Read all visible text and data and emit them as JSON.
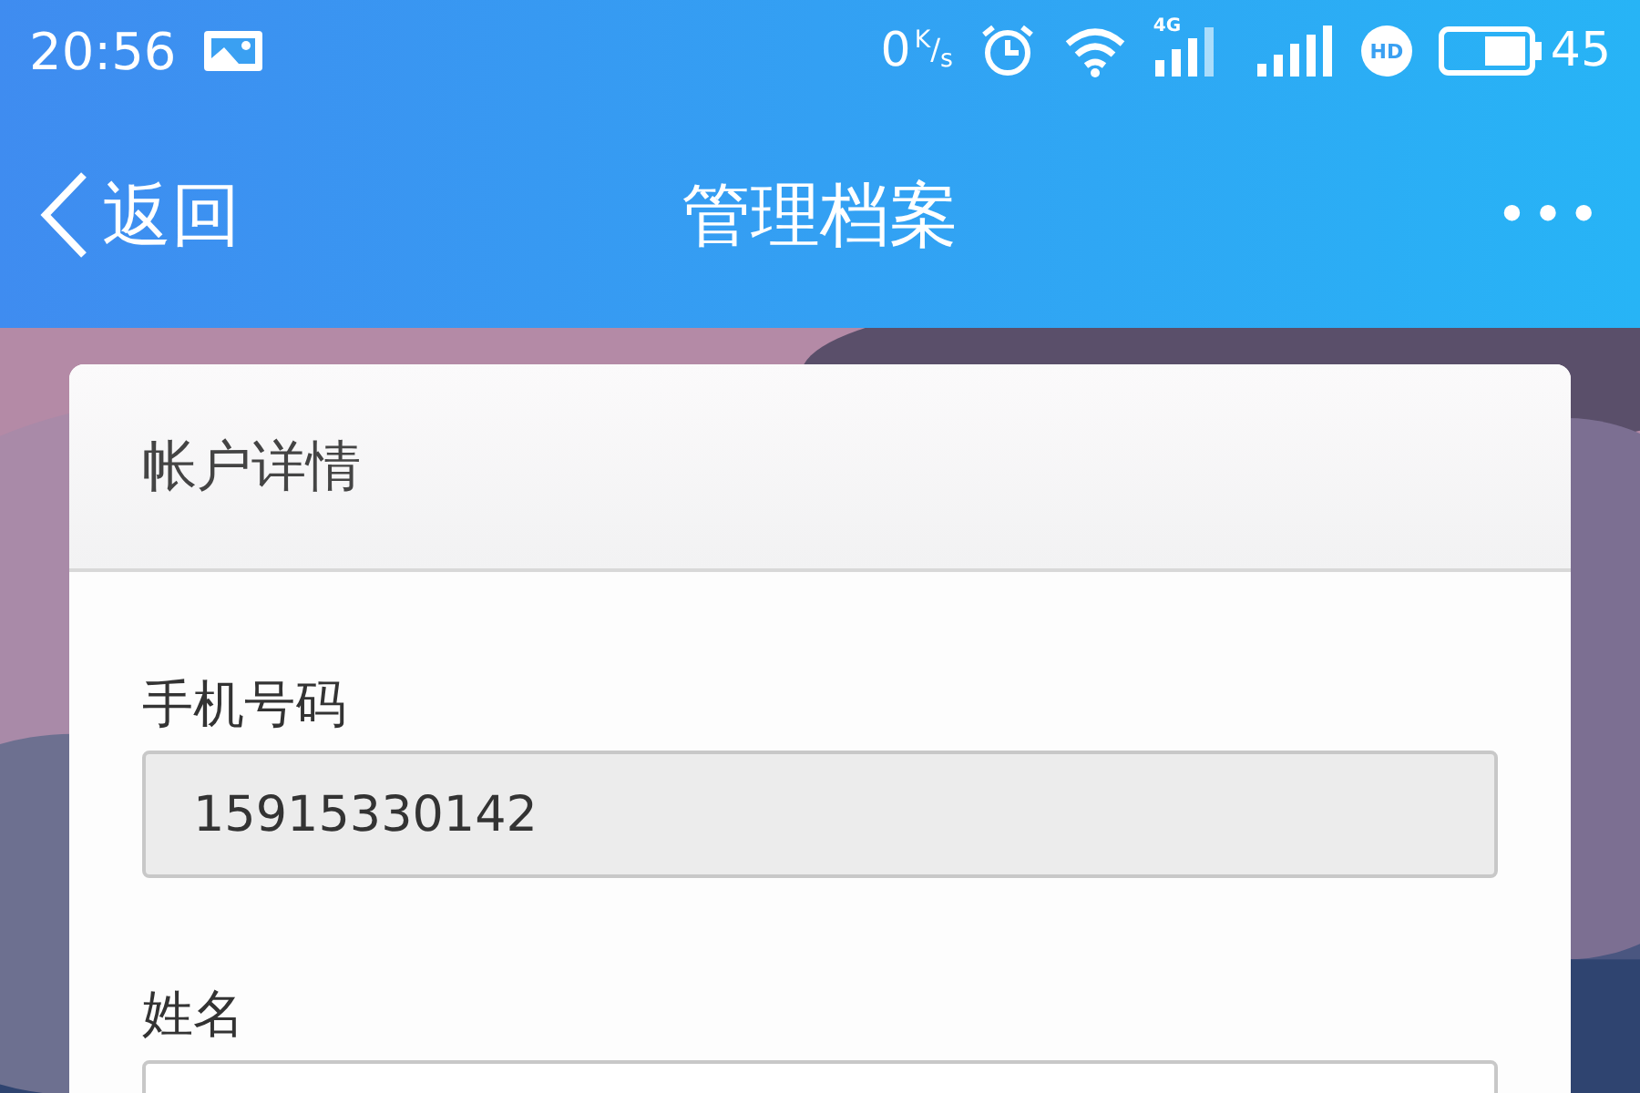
{
  "status_bar": {
    "time": "20:56",
    "speed": "0",
    "speed_unit": "$^{K}$/$_{s}$",
    "network": "4G",
    "hd": "HD",
    "battery": "45"
  },
  "nav_bar": {
    "back": "返回",
    "title": "管理档案",
    "more": "•••"
  },
  "card": {
    "title": "帐户详情",
    "fields": [
      {
        "label": "手机号码",
        "value": "15915330142",
        "disabled": true
      },
      {
        "label": "姓名",
        "disabled": false
      }
    ]
  }
}
